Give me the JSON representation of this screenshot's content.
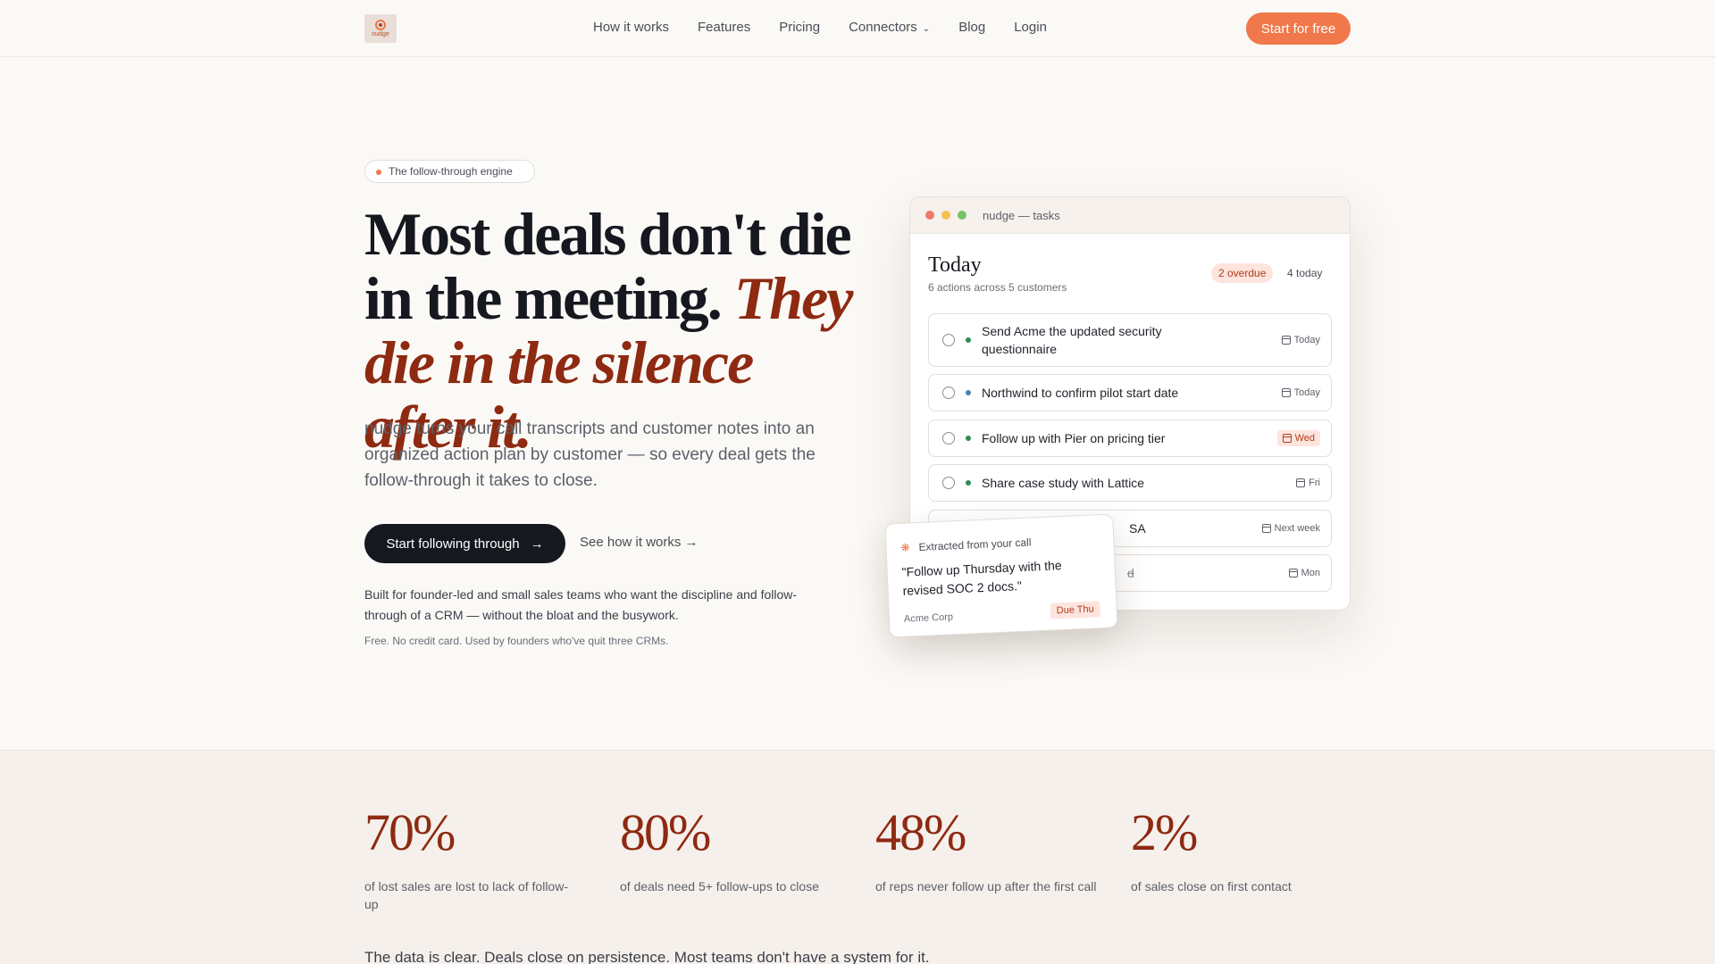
{
  "nav": {
    "logo_text": "nudge",
    "links": [
      "How it works",
      "Features",
      "Pricing",
      "Connectors",
      "Blog",
      "Login"
    ],
    "cta": "Start for free"
  },
  "hero": {
    "pill": "The follow-through engine",
    "headline_plain": "Most deals don't die in the meeting.",
    "headline_accent": "They die in the silence after it.",
    "subtitle": "nudge turns your call transcripts and customer notes into an organized action plan by customer — so every deal gets the follow-through it takes to close.",
    "primary_cta": "Start following through",
    "secondary_cta": "See how it works →",
    "built_for": "Built for founder-led and small sales teams who want the discipline and follow-through of a CRM — without the bloat and the busywork.",
    "fine_print": "Free. No credit card. Used by founders who've quit three CRMs."
  },
  "app": {
    "window_title": "nudge — tasks",
    "heading": "Today",
    "subheading": "6 actions across 5 customers",
    "overdue_badge": "2 overdue",
    "today_badge": "4 today",
    "tasks": [
      {
        "text": "Send Acme the updated security questionnaire",
        "due": "Today"
      },
      {
        "text": "Northwind to confirm pilot start date",
        "due": "Today"
      },
      {
        "text": "Follow up with Pier on pricing tier",
        "due": "Wed"
      },
      {
        "text": "Share case study with Lattice",
        "due": "Fri"
      },
      {
        "text": "SA",
        "due": "Next week"
      },
      {
        "text": "d",
        "due": "Mon"
      }
    ]
  },
  "float_card": {
    "title": "Extracted from your call",
    "quote": "\"Follow up Thursday with the revised SOC 2 docs.\"",
    "company": "Acme Corp",
    "due": "Due Thu"
  },
  "stats": {
    "items": [
      {
        "value": "70%",
        "label": "of lost sales are lost to lack of follow-up"
      },
      {
        "value": "80%",
        "label": "of deals need 5+ follow-ups to close"
      },
      {
        "value": "48%",
        "label": "of reps never follow up after the first call"
      },
      {
        "value": "2%",
        "label": "of sales close on first contact"
      }
    ],
    "conclusion": "The data is clear. Deals close on persistence. Most teams don't have a system for it."
  },
  "colors": {
    "accent": "#f0784a",
    "brand_dark": "#16181f",
    "headline_accent": "#8e2a12",
    "overdue": "#b13c1e",
    "background": "#fbf9f6"
  }
}
